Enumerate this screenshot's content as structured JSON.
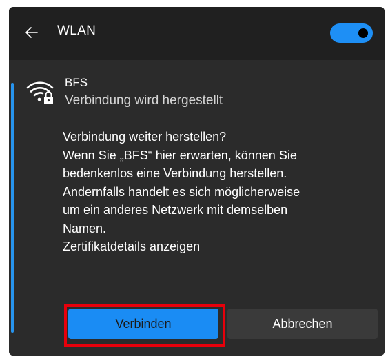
{
  "header": {
    "back_icon": "arrow-left-icon",
    "title": "WLAN",
    "toggle_on": true,
    "toggle_color": "#1e8ff5"
  },
  "network": {
    "icon": "wifi-secured-icon",
    "name": "BFS",
    "status": "Verbindung wird hergestellt"
  },
  "message": {
    "lines": [
      "Verbindung weiter herstellen?",
      "Wenn Sie „BFS“ hier erwarten, können Sie",
      "bedenkenlos eine Verbindung herstellen.",
      "Andernfalls handelt es sich möglicherweise",
      "um ein anderes Netzwerk mit demselben",
      "Namen."
    ],
    "cert_link": "Zertifikatdetails anzeigen"
  },
  "buttons": {
    "connect": "Verbinden",
    "cancel": "Abbrechen"
  },
  "colors": {
    "panel_bg": "#202020",
    "card_bg": "#2b2b2b",
    "accent": "#1a8cf4",
    "highlight": "#e8000b"
  }
}
